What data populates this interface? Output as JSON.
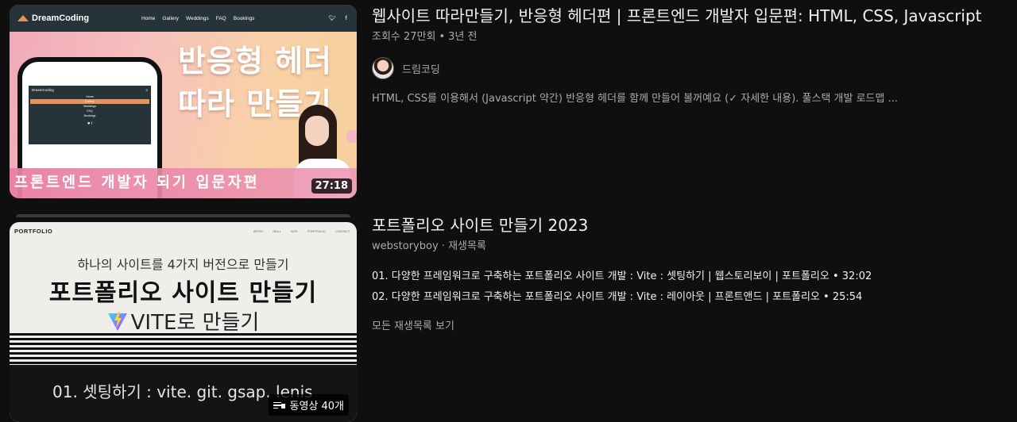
{
  "results": [
    {
      "title": "웹사이트 따라만들기, 반응형 헤더편 | 프론트엔드 개발자 입문편: HTML, CSS, Javascript",
      "views": "조회수 27만회",
      "age": "3년 전",
      "channel": "드림코딩",
      "description": "HTML, CSS를 이용해서 (Javascript 약간) 반응형 헤더를 함께 만들어 볼꺼예요 (✓ 자세한 내용). 풀스택 개발 로드맵 ...",
      "duration": "27:18",
      "thumbnail": {
        "logo": "DreamCoding",
        "menu": [
          "Home",
          "Gallery",
          "Weddings",
          "FAQ",
          "Bookings"
        ],
        "social": [
          "twitter-icon",
          "facebook-icon"
        ],
        "phone_menu": [
          "Home",
          "Gallery",
          "Weddings",
          "FAQ",
          "Bookings"
        ],
        "phone_social": "♥ f",
        "title_line1": "반응형 헤더",
        "title_line2": "따라 만들기",
        "subtitle": "프론트엔드 개발자 되기 입문자편"
      }
    },
    {
      "title": "포트폴리오 사이트 만들기 2023",
      "channel": "webstoryboy",
      "type_label": "재생목록",
      "videos": [
        "01. 다양한 프레임워크로 구축하는 포트폴리오 사이트 개발 : Vite : 셋팅하기 | 웹스토리보이 | 포트폴리오 • 32:02",
        "02. 다양한 프레임워크로 구축하는 포트폴리오 사이트 개발 : Vite : 레이아웃 | 프론트앤드 | 포트폴리오 • 25:54"
      ],
      "view_all": "모든 재생목록 보기",
      "badge": "동영상 40개",
      "thumbnail": {
        "logo": "PORTFOLIO",
        "menu": [
          "INTRO",
          "SKILL",
          "SITE",
          "PORTFOLIO",
          "CONTACT"
        ],
        "line1": "하나의 사이트를 4가지 버전으로 만들기",
        "line2": "포트폴리오 사이트 만들기",
        "line3": "VITE로 만들기",
        "episode": "01. 셋팅하기 : vite. git. gsap. lenis"
      }
    }
  ],
  "colors": {
    "background": "#0f0f0f",
    "text_primary": "#f1f1f1",
    "text_secondary": "#aaaaaa"
  }
}
